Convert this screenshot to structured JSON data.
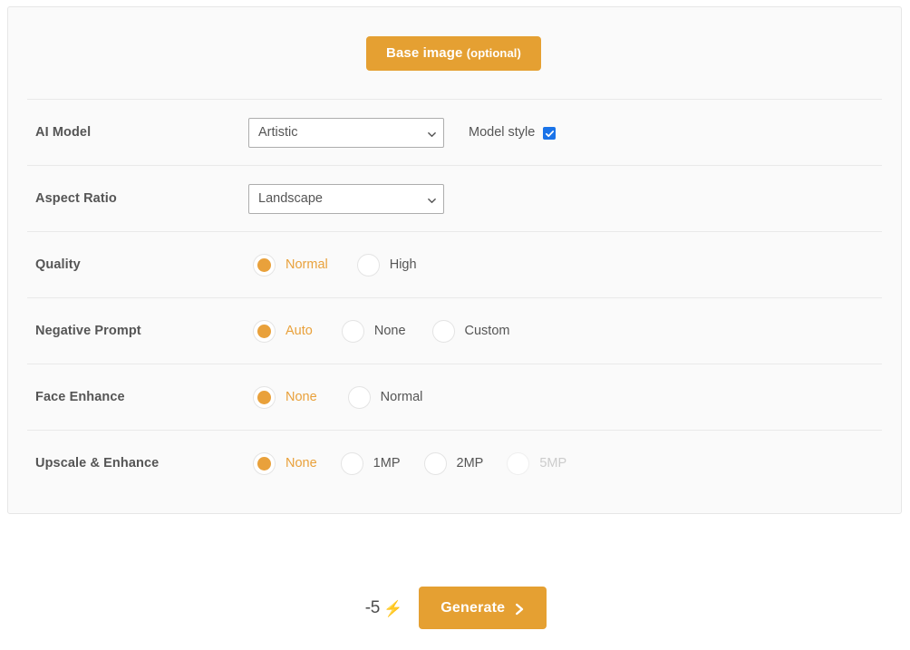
{
  "panel": {
    "base_image": {
      "label": "Base image",
      "optional_suffix": "(optional)"
    },
    "rows": [
      {
        "label": "AI Model",
        "type": "select",
        "value": "Artistic",
        "options": [
          "Artistic"
        ],
        "checkbox": {
          "label": "Model style",
          "checked": true,
          "color": "#1a73e8"
        }
      },
      {
        "label": "Aspect Ratio",
        "type": "select",
        "value": "Landscape",
        "options": [
          "Landscape"
        ]
      },
      {
        "label": "Quality",
        "type": "radio",
        "options": [
          {
            "label": "Normal",
            "selected": true,
            "disabled": false
          },
          {
            "label": "High",
            "selected": false,
            "disabled": false
          }
        ]
      },
      {
        "label": "Negative Prompt",
        "type": "radio",
        "options": [
          {
            "label": "Auto",
            "selected": true,
            "disabled": false
          },
          {
            "label": "None",
            "selected": false,
            "disabled": false
          },
          {
            "label": "Custom",
            "selected": false,
            "disabled": false
          }
        ]
      },
      {
        "label": "Face Enhance",
        "type": "radio",
        "options": [
          {
            "label": "None",
            "selected": true,
            "disabled": false
          },
          {
            "label": "Normal",
            "selected": false,
            "disabled": false
          }
        ]
      },
      {
        "label": "Upscale & Enhance",
        "type": "radio",
        "options": [
          {
            "label": "None",
            "selected": true,
            "disabled": false
          },
          {
            "label": "1MP",
            "selected": false,
            "disabled": false
          },
          {
            "label": "2MP",
            "selected": false,
            "disabled": false
          },
          {
            "label": "5MP",
            "selected": false,
            "disabled": true
          }
        ]
      }
    ]
  },
  "footer": {
    "credit_cost": "-5",
    "credit_icon": "lightning-bolt",
    "credit_icon_glyph": "⚡",
    "generate_label": "Generate",
    "generate_chevron_icon": "chevron-right-icon"
  },
  "colors": {
    "accent": "#e5a032",
    "accent_light": "#e9a13b",
    "checkbox_blue": "#1a73e8",
    "panel_bg": "#fafafa",
    "panel_border": "#e6e6e6",
    "divider": "#e9e9e9",
    "label_text": "#555555",
    "disabled_text": "#cccccc"
  }
}
